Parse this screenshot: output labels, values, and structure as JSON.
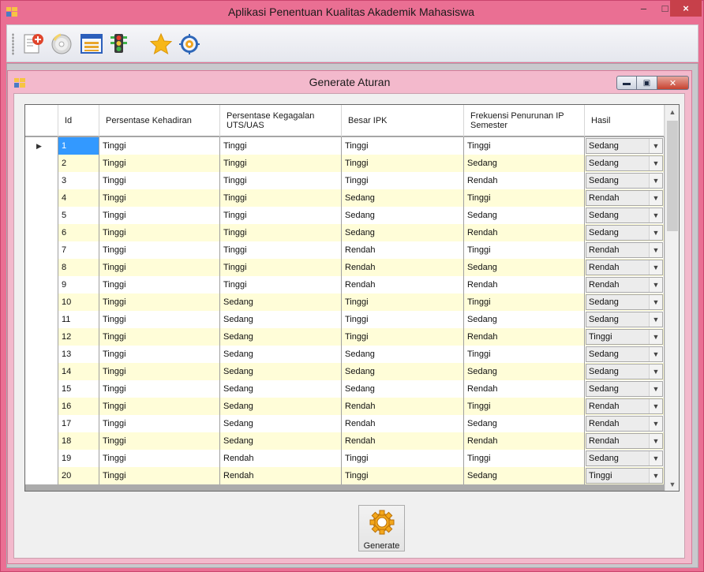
{
  "app": {
    "title": "Aplikasi Penentuan Kualitas Akademik Mahasiswa",
    "min_glyph": "–",
    "max_glyph": "□",
    "close_glyph": "×"
  },
  "toolbar": {
    "icons": [
      "document-add-icon",
      "disc-icon",
      "list-window-icon",
      "traffic-light-icon",
      "star-icon",
      "gear-target-icon"
    ]
  },
  "child": {
    "title": "Generate Aturan",
    "min_glyph": "▬",
    "max_glyph": "▣",
    "close_glyph": "✕"
  },
  "grid": {
    "columns": [
      "Id",
      "Persentase Kehadiran",
      "Persentase Kegagalan UTS/UAS",
      "Besar IPK",
      "Frekuensi Penurunan IP Semester",
      "Hasil"
    ],
    "current_row_marker": "▶",
    "rows": [
      {
        "id": "1",
        "kehadiran": "Tinggi",
        "kegagalan": "Tinggi",
        "ipk": "Tinggi",
        "frekuensi": "Tinggi",
        "hasil": "Sedang"
      },
      {
        "id": "2",
        "kehadiran": "Tinggi",
        "kegagalan": "Tinggi",
        "ipk": "Tinggi",
        "frekuensi": "Sedang",
        "hasil": "Sedang"
      },
      {
        "id": "3",
        "kehadiran": "Tinggi",
        "kegagalan": "Tinggi",
        "ipk": "Tinggi",
        "frekuensi": "Rendah",
        "hasil": "Sedang"
      },
      {
        "id": "4",
        "kehadiran": "Tinggi",
        "kegagalan": "Tinggi",
        "ipk": "Sedang",
        "frekuensi": "Tinggi",
        "hasil": "Rendah"
      },
      {
        "id": "5",
        "kehadiran": "Tinggi",
        "kegagalan": "Tinggi",
        "ipk": "Sedang",
        "frekuensi": "Sedang",
        "hasil": "Sedang"
      },
      {
        "id": "6",
        "kehadiran": "Tinggi",
        "kegagalan": "Tinggi",
        "ipk": "Sedang",
        "frekuensi": "Rendah",
        "hasil": "Sedang"
      },
      {
        "id": "7",
        "kehadiran": "Tinggi",
        "kegagalan": "Tinggi",
        "ipk": "Rendah",
        "frekuensi": "Tinggi",
        "hasil": "Rendah"
      },
      {
        "id": "8",
        "kehadiran": "Tinggi",
        "kegagalan": "Tinggi",
        "ipk": "Rendah",
        "frekuensi": "Sedang",
        "hasil": "Rendah"
      },
      {
        "id": "9",
        "kehadiran": "Tinggi",
        "kegagalan": "Tinggi",
        "ipk": "Rendah",
        "frekuensi": "Rendah",
        "hasil": "Rendah"
      },
      {
        "id": "10",
        "kehadiran": "Tinggi",
        "kegagalan": "Sedang",
        "ipk": "Tinggi",
        "frekuensi": "Tinggi",
        "hasil": "Sedang"
      },
      {
        "id": "11",
        "kehadiran": "Tinggi",
        "kegagalan": "Sedang",
        "ipk": "Tinggi",
        "frekuensi": "Sedang",
        "hasil": "Sedang"
      },
      {
        "id": "12",
        "kehadiran": "Tinggi",
        "kegagalan": "Sedang",
        "ipk": "Tinggi",
        "frekuensi": "Rendah",
        "hasil": "Tinggi"
      },
      {
        "id": "13",
        "kehadiran": "Tinggi",
        "kegagalan": "Sedang",
        "ipk": "Sedang",
        "frekuensi": "Tinggi",
        "hasil": "Sedang"
      },
      {
        "id": "14",
        "kehadiran": "Tinggi",
        "kegagalan": "Sedang",
        "ipk": "Sedang",
        "frekuensi": "Sedang",
        "hasil": "Sedang"
      },
      {
        "id": "15",
        "kehadiran": "Tinggi",
        "kegagalan": "Sedang",
        "ipk": "Sedang",
        "frekuensi": "Rendah",
        "hasil": "Sedang"
      },
      {
        "id": "16",
        "kehadiran": "Tinggi",
        "kegagalan": "Sedang",
        "ipk": "Rendah",
        "frekuensi": "Tinggi",
        "hasil": "Rendah"
      },
      {
        "id": "17",
        "kehadiran": "Tinggi",
        "kegagalan": "Sedang",
        "ipk": "Rendah",
        "frekuensi": "Sedang",
        "hasil": "Rendah"
      },
      {
        "id": "18",
        "kehadiran": "Tinggi",
        "kegagalan": "Sedang",
        "ipk": "Rendah",
        "frekuensi": "Rendah",
        "hasil": "Rendah"
      },
      {
        "id": "19",
        "kehadiran": "Tinggi",
        "kegagalan": "Rendah",
        "ipk": "Tinggi",
        "frekuensi": "Tinggi",
        "hasil": "Sedang"
      },
      {
        "id": "20",
        "kehadiran": "Tinggi",
        "kegagalan": "Rendah",
        "ipk": "Tinggi",
        "frekuensi": "Sedang",
        "hasil": "Tinggi"
      }
    ]
  },
  "generate": {
    "label": "Generate"
  },
  "colors": {
    "title_bar": "#ea6f93",
    "row_alt": "#fffdd8",
    "selection": "#3399ff"
  }
}
